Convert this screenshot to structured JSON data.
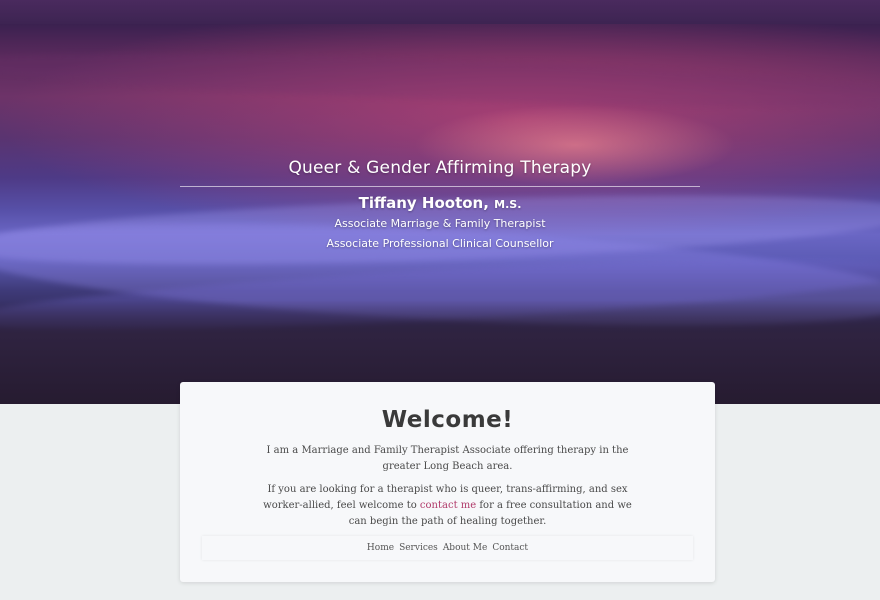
{
  "hero": {
    "tagline": "Queer & Gender Affirming Therapy",
    "name": "Tiffany Hooton,",
    "credential": "M.S.",
    "roles": [
      "Associate Marriage & Family Therapist",
      "Associate Professional Clinical Counsellor"
    ]
  },
  "welcome": {
    "title": "Welcome!",
    "paragraph1": "I am a Marriage and Family Therapist Associate offering therapy in the greater Long Beach area.",
    "paragraph2_before": "If you are looking for a therapist who is queer, trans-affirming, and sex worker-allied, feel welcome to",
    "paragraph2_link": "contact me",
    "paragraph2_after": "for a free consultation and we can begin the path of healing together."
  },
  "nav": {
    "items": [
      "Home",
      "Services",
      "About Me",
      "Contact"
    ]
  }
}
